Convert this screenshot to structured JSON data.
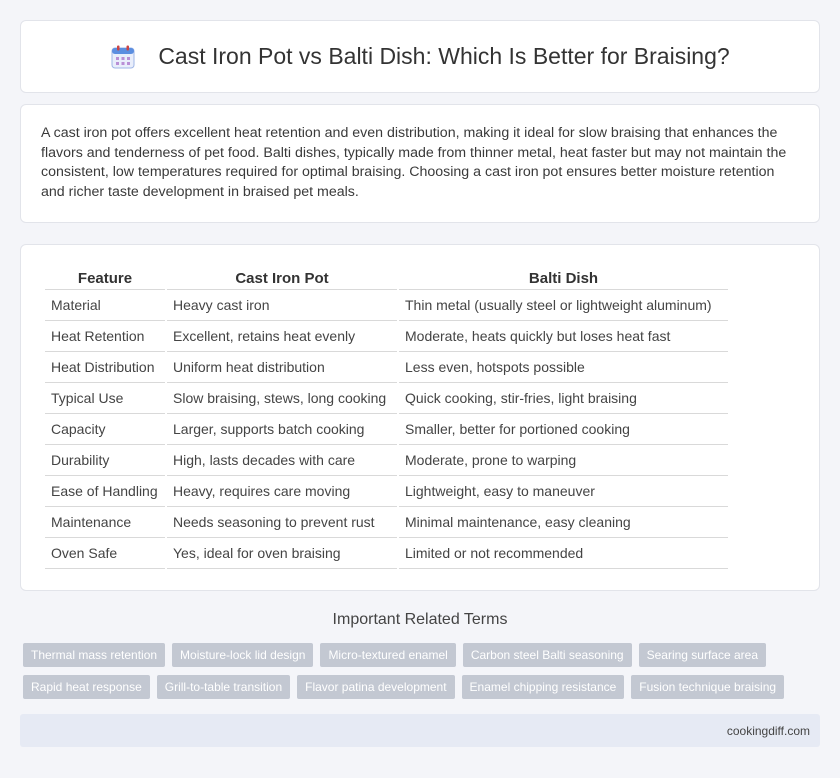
{
  "header": {
    "icon": "calendar-icon",
    "title": "Cast Iron Pot vs Balti Dish: Which Is Better for Braising?"
  },
  "intro": {
    "text": "A cast iron pot offers excellent heat retention and even distribution, making it ideal for slow braising that enhances the flavors and tenderness of pet food. Balti dishes, typically made from thinner metal, heat faster but may not maintain the consistent, low temperatures required for optimal braising. Choosing a cast iron pot ensures better moisture retention and richer taste development in braised pet meals."
  },
  "table": {
    "headers": [
      "Feature",
      "Cast Iron Pot",
      "Balti Dish"
    ],
    "rows": [
      [
        "Material",
        "Heavy cast iron",
        "Thin metal (usually steel or lightweight aluminum)"
      ],
      [
        "Heat Retention",
        "Excellent, retains heat evenly",
        "Moderate, heats quickly but loses heat fast"
      ],
      [
        "Heat Distribution",
        "Uniform heat distribution",
        "Less even, hotspots possible"
      ],
      [
        "Typical Use",
        "Slow braising, stews, long cooking",
        "Quick cooking, stir-fries, light braising"
      ],
      [
        "Capacity",
        "Larger, supports batch cooking",
        "Smaller, better for portioned cooking"
      ],
      [
        "Durability",
        "High, lasts decades with care",
        "Moderate, prone to warping"
      ],
      [
        "Ease of Handling",
        "Heavy, requires care moving",
        "Lightweight, easy to maneuver"
      ],
      [
        "Maintenance",
        "Needs seasoning to prevent rust",
        "Minimal maintenance, easy cleaning"
      ],
      [
        "Oven Safe",
        "Yes, ideal for oven braising",
        "Limited or not recommended"
      ]
    ]
  },
  "related": {
    "title": "Important Related Terms",
    "tags": [
      "Thermal mass retention",
      "Moisture-lock lid design",
      "Micro-textured enamel",
      "Carbon steel Balti seasoning",
      "Searing surface area",
      "Rapid heat response",
      "Grill-to-table transition",
      "Flavor patina development",
      "Enamel chipping resistance",
      "Fusion technique braising"
    ]
  },
  "footer": {
    "site": "cookingdiff.com"
  },
  "colors": {
    "tag_bg": "#c3c8d2",
    "footer_bg": "#e6eaf4",
    "icon_blue": "#4a7fd6"
  }
}
